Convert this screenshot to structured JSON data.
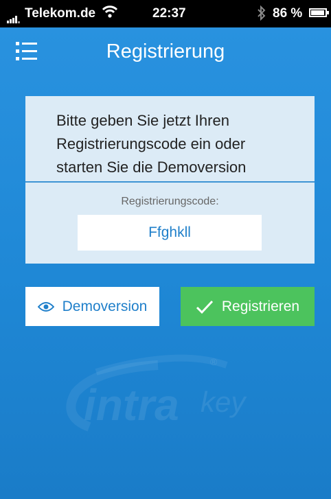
{
  "status_bar": {
    "carrier": "Telekom.de",
    "time": "22:37",
    "battery": "86 %",
    "battery_level": 0.86
  },
  "nav": {
    "title": "Registrierung",
    "menu_icon": "list-menu-icon"
  },
  "card": {
    "prompt": "Bitte geben Sie jetzt Ihren\nRegistrierungscode ein oder\nstarten Sie die Demoversion",
    "code_label": "Registrierungscode:",
    "code_value": "Ffghkll"
  },
  "buttons": {
    "demo_label": "Demoversion",
    "demo_icon": "eye-icon",
    "register_label": "Registrieren",
    "register_icon": "checkmark-icon"
  },
  "logo": {
    "text_intra": "intra",
    "text_key": "key",
    "registered": "®"
  },
  "colors": {
    "background": "#2a93e0",
    "card": "#dcebf6",
    "accent_blue": "#1f7fca",
    "register_green": "#4cc35d"
  }
}
